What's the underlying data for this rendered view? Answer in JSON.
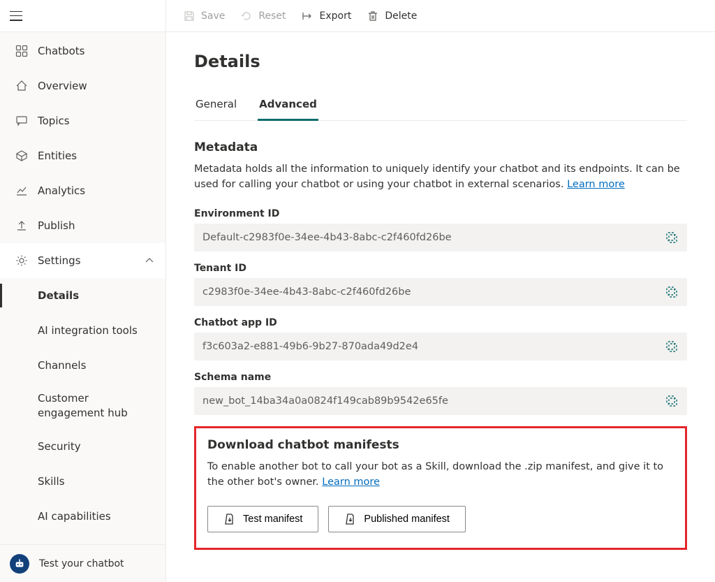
{
  "commandbar": {
    "save": "Save",
    "reset": "Reset",
    "export": "Export",
    "delete": "Delete"
  },
  "sidebar": {
    "items": [
      {
        "label": "Chatbots"
      },
      {
        "label": "Overview"
      },
      {
        "label": "Topics"
      },
      {
        "label": "Entities"
      },
      {
        "label": "Analytics"
      },
      {
        "label": "Publish"
      }
    ],
    "settings_label": "Settings",
    "settings_children": [
      {
        "label": "Details"
      },
      {
        "label": "AI integration tools"
      },
      {
        "label": "Channels"
      },
      {
        "label": "Customer engagement hub"
      },
      {
        "label": "Security"
      },
      {
        "label": "Skills"
      },
      {
        "label": "AI capabilities"
      }
    ],
    "footer_label": "Test your chatbot"
  },
  "page": {
    "title": "Details",
    "tabs": [
      {
        "label": "General"
      },
      {
        "label": "Advanced"
      }
    ],
    "metadata": {
      "heading": "Metadata",
      "desc": "Metadata holds all the information to uniquely identify your chatbot and its endpoints. It can be used for calling your chatbot or using your chatbot in external scenarios. ",
      "learn_more": "Learn more"
    },
    "fields": [
      {
        "label": "Environment ID",
        "value": "Default-c2983f0e-34ee-4b43-8abc-c2f460fd26be"
      },
      {
        "label": "Tenant ID",
        "value": "c2983f0e-34ee-4b43-8abc-c2f460fd26be"
      },
      {
        "label": "Chatbot app ID",
        "value": "f3c603a2-e881-49b6-9b27-870ada49d2e4"
      },
      {
        "label": "Schema name",
        "value": "new_bot_14ba34a0a0824f149cab89b9542e65fe"
      }
    ],
    "manifests": {
      "heading": "Download chatbot manifests",
      "desc": "To enable another bot to call your bot as a Skill, download the .zip manifest, and give it to the other bot's owner. ",
      "learn_more": "Learn more",
      "test_btn": "Test manifest",
      "pub_btn": "Published manifest"
    }
  }
}
